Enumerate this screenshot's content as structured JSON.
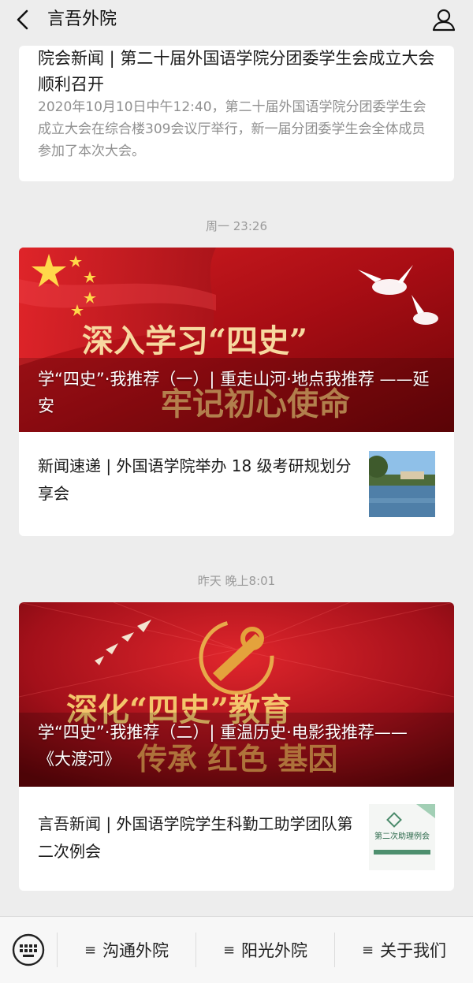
{
  "header": {
    "title": "言吾外院",
    "back_icon": "chevron-left-icon",
    "profile_icon": "user-icon"
  },
  "feed": {
    "card1": {
      "title": "院会新闻 | 第二十届外国语学院分团委学生会成立大会顺利召开",
      "description": "2020年10月10日中午12:40，第二十届外国语学院分团委学生会成立大会在综合楼309会议厅举行，新一届分团委学生会全体成员参加了本次大会。"
    },
    "group2": {
      "time": "周一 23:26",
      "cover_title": "学“四史”·我推荐（一）| 重走山河·地点我推荐 ——延安",
      "cover_art_text1": "深入学习“四史”",
      "cover_art_text2": "牢记初心使命",
      "sub_title": "新闻速递 | 外国语学院举办 18 级考研规划分享会"
    },
    "group3": {
      "time": "昨天 晚上8:01",
      "cover_title": "学“四史”·我推荐（二）| 重温历史·电影我推荐——《大渡河》",
      "cover_art_text1": "深化“四史”教育",
      "cover_art_text2": "传承 红色 基因",
      "sub_title": "言吾新闻 | 外国语学院学生科勤工助学团队第二次例会",
      "thumb_text": "第二次助理例会"
    }
  },
  "bottom_bar": {
    "keyboard_icon": "keyboard-icon",
    "menu": [
      {
        "label": "沟通外院",
        "icon": "≡"
      },
      {
        "label": "阳光外院",
        "icon": "≡"
      },
      {
        "label": "关于我们",
        "icon": "≡"
      }
    ]
  },
  "colors": {
    "background": "#ededed",
    "card": "#ffffff",
    "cover_red": "#b3121a",
    "muted_text": "#8f8f8f"
  }
}
